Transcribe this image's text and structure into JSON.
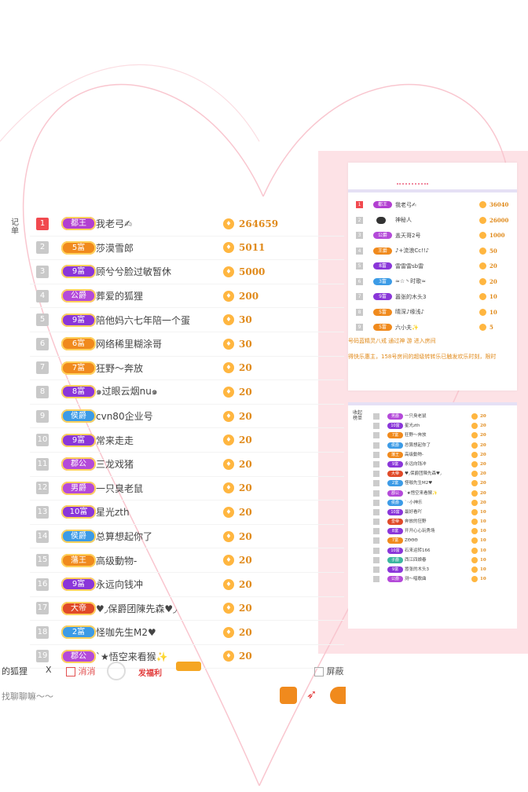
{
  "colors": {
    "accent_pink": "#fde2e6",
    "rank_top": "#f1494f",
    "coin": "#ffb640",
    "amount": "#e08a1b"
  },
  "main": {
    "side_tab": "记单",
    "rows": [
      {
        "rank": "1",
        "badge": "都王",
        "badge_color": "#b23fd1",
        "name": "我老弓✍",
        "amount": "264659"
      },
      {
        "rank": "2",
        "badge": "5富",
        "badge_color": "#f08a1d",
        "name": "莎漠雪郎",
        "amount": "5011"
      },
      {
        "rank": "3",
        "badge": "9富",
        "badge_color": "#8a36d9",
        "name": "顾兮兮脸过敏暂休",
        "amount": "5000"
      },
      {
        "rank": "4",
        "badge": "公爵",
        "badge_color": "#b44ad9",
        "name": "葬爱的狐狸",
        "amount": "200"
      },
      {
        "rank": "5",
        "badge": "9富",
        "badge_color": "#8a36d9",
        "name": "陪他妈六七年陪一个蛋",
        "amount": "30"
      },
      {
        "rank": "6",
        "badge": "6富",
        "badge_color": "#f08a1d",
        "name": "网络稀里糊涂哥",
        "amount": "30"
      },
      {
        "rank": "7",
        "badge": "7富",
        "badge_color": "#f08a1d",
        "name": "狂野～奔放",
        "amount": "20"
      },
      {
        "rank": "8",
        "badge": "8富",
        "badge_color": "#8a36d9",
        "name": "๑过眼云烟nu๑",
        "amount": "20"
      },
      {
        "rank": "9",
        "badge": "侯爵",
        "badge_color": "#3c9be6",
        "name": "cvn80企业号",
        "amount": "20"
      },
      {
        "rank": "10",
        "badge": "9富",
        "badge_color": "#8a36d9",
        "name": "常来走走",
        "amount": "20"
      },
      {
        "rank": "11",
        "badge": "郡公",
        "badge_color": "#b44ad9",
        "name": "三龙戏猪",
        "amount": "20"
      },
      {
        "rank": "12",
        "badge": "男爵",
        "badge_color": "#b44ad9",
        "name": "一只臭老鼠",
        "amount": "20"
      },
      {
        "rank": "13",
        "badge": "10富",
        "badge_color": "#8a36d9",
        "name": "星光zth",
        "amount": "20"
      },
      {
        "rank": "14",
        "badge": "侯爵",
        "badge_color": "#3c9be6",
        "name": "总算想起你了",
        "amount": "20"
      },
      {
        "rank": "15",
        "badge": "藩王",
        "badge_color": "#f08a1d",
        "name": "高级動物-",
        "amount": "20"
      },
      {
        "rank": "16",
        "badge": "9富",
        "badge_color": "#8a36d9",
        "name": "永远向钱冲",
        "amount": "20"
      },
      {
        "rank": "17",
        "badge": "大帝",
        "badge_color": "#e04a28",
        "name": "♥◞保爵团陳先森♥◞",
        "amount": "20"
      },
      {
        "rank": "18",
        "badge": "2富",
        "badge_color": "#3c9be6",
        "name": "怪咖先生M2♥",
        "amount": "20"
      },
      {
        "rank": "19",
        "badge": "郡公",
        "badge_color": "#b44ad9",
        "name": "ˋ★悟空来看猴✨",
        "amount": "20"
      }
    ]
  },
  "bottom_bar": {
    "left_text": "的狐狸",
    "close_x": "X",
    "check_label": "消消",
    "gift_label": "发福利",
    "right_check": "屏蔽",
    "chat_placeholder": "找聊聊嘛～～"
  },
  "right_top": {
    "rows": [
      {
        "rank": "1",
        "badge": "都王",
        "badge_color": "#b23fd1",
        "name": "我老弓✍",
        "amount": "36040"
      },
      {
        "rank": "2",
        "badge": "",
        "badge_color": "",
        "name": "神秘人",
        "amount": "26000"
      },
      {
        "rank": "3",
        "badge": "公爵",
        "badge_color": "#b44ad9",
        "name": "盖天哥2号",
        "amount": "1000"
      },
      {
        "rank": "4",
        "badge": "王爵",
        "badge_color": "#f08a1d",
        "name": "♪+流浪Cc!!♪",
        "amount": "50"
      },
      {
        "rank": "5",
        "badge": "8富",
        "badge_color": "#8a36d9",
        "name": "雷雷雷sb雷",
        "amount": "20"
      },
      {
        "rank": "6",
        "badge": "3富",
        "badge_color": "#3c9be6",
        "name": "≈☆丶时歌≈",
        "amount": "20"
      },
      {
        "rank": "7",
        "badge": "9富",
        "badge_color": "#8a36d9",
        "name": "嚣张的木头3",
        "amount": "10"
      },
      {
        "rank": "8",
        "badge": "5富",
        "badge_color": "#f08a1d",
        "name": "晴深♪缘浅♪",
        "amount": "10"
      },
      {
        "rank": "9",
        "badge": "5富",
        "badge_color": "#f08a1d",
        "name": "六小夫✨",
        "amount": "5"
      }
    ],
    "note1": "号码蓝精灵八戒 通过神 游 进入房间",
    "note2": "得快乐惠主，158号房间的超级转转乐已触发欢乐时刻，限时"
  },
  "right_bottom": {
    "tab": "收起榜单",
    "rows": [
      {
        "badge": "男爵",
        "badge_color": "#b44ad9",
        "name": "一只臭老鼠",
        "amount": "20"
      },
      {
        "badge": "10富",
        "badge_color": "#8a36d9",
        "name": "星光zth",
        "amount": "20"
      },
      {
        "badge": "7富",
        "badge_color": "#f08a1d",
        "name": "狂野～奔放",
        "amount": "20"
      },
      {
        "badge": "侯爵",
        "badge_color": "#3c9be6",
        "name": "总算想起你了",
        "amount": "20"
      },
      {
        "badge": "藩王",
        "badge_color": "#f08a1d",
        "name": "高级動物-",
        "amount": "20"
      },
      {
        "badge": "9富",
        "badge_color": "#8a36d9",
        "name": "永远向钱冲",
        "amount": "20"
      },
      {
        "badge": "大帝",
        "badge_color": "#e04a28",
        "name": "♥◞保爵团陳先森♥◞",
        "amount": "20"
      },
      {
        "badge": "2富",
        "badge_color": "#3c9be6",
        "name": "怪咖先生M2♥",
        "amount": "20"
      },
      {
        "badge": "郡公",
        "badge_color": "#b44ad9",
        "name": "ˋ★悟空来看猴✨",
        "amount": "20"
      },
      {
        "badge": "侯爵",
        "badge_color": "#3c9be6",
        "name": "ˋ◦小神乐",
        "amount": "20"
      },
      {
        "badge": "10富",
        "badge_color": "#8a36d9",
        "name": "最好看吖",
        "amount": "10"
      },
      {
        "badge": "皇帝",
        "badge_color": "#e04a28",
        "name": "奔放的狂野",
        "amount": "10"
      },
      {
        "badge": "8富",
        "badge_color": "#8a36d9",
        "name": "开开心心玩秀场",
        "amount": "10"
      },
      {
        "badge": "7富",
        "badge_color": "#f08a1d",
        "name": "ZΘΘΘ",
        "amount": "10"
      },
      {
        "badge": "10富",
        "badge_color": "#8a36d9",
        "name": "石来运转166",
        "amount": "10"
      },
      {
        "badge": "子爵",
        "badge_color": "#3cb6a0",
        "name": "西江四娘春",
        "amount": "10"
      },
      {
        "badge": "9富",
        "badge_color": "#8a36d9",
        "name": "嚣张的木头3",
        "amount": "10"
      },
      {
        "badge": "公爵",
        "badge_color": "#b44ad9",
        "name": "测～唱歌曲",
        "amount": "10"
      }
    ]
  }
}
